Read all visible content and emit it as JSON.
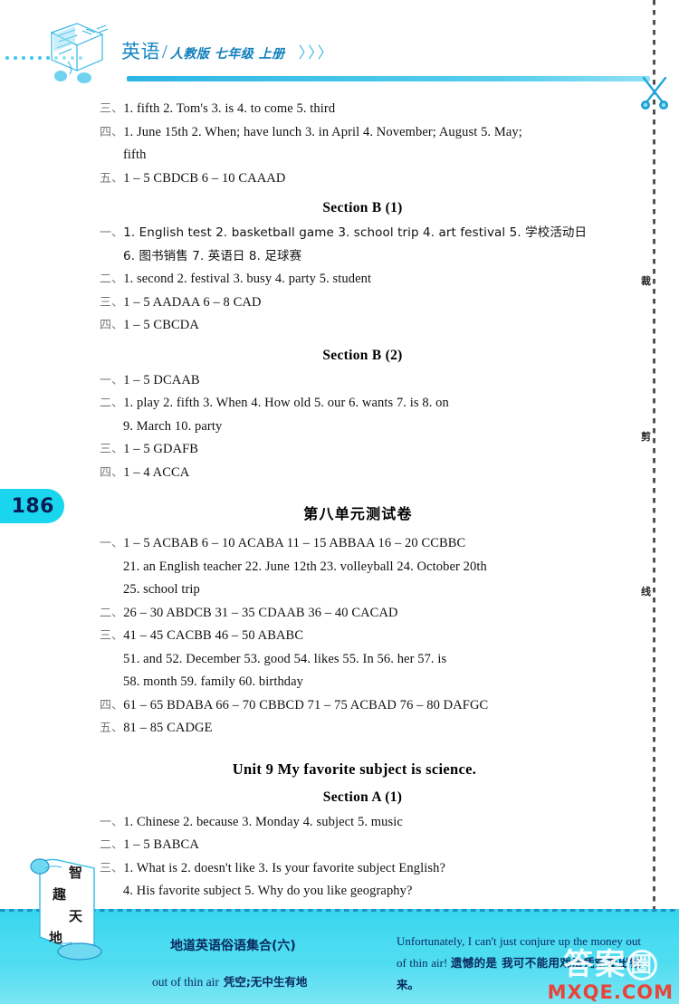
{
  "header": {
    "subject": "英语",
    "slash": "/",
    "edition": "人教版  七年级  上册",
    "chevrons": "〉〉〉"
  },
  "page_number": "186",
  "cut_line": {
    "scissors_icon": "scissors-icon",
    "chars": [
      "裁",
      "剪",
      "线"
    ]
  },
  "content": {
    "blocks": [
      {
        "lines": [
          {
            "num": "三、",
            "text": "1. fifth   2. Tom's   3. is   4. to come   5. third"
          },
          {
            "num": "四、",
            "text": "1. June 15th   2. When; have lunch   3. in April   4. November; August   5. May;"
          },
          {
            "num": "",
            "text": "fifth"
          },
          {
            "num": "五、",
            "text": "1 – 5 CBDCB   6 – 10 CAAAD"
          }
        ]
      }
    ],
    "heading_section_b1": "Section B (1)",
    "section_b1_lines": [
      {
        "num": "一、",
        "text": "1. English test   2. basketball game   3. school trip   4. art festival   5. 学校活动日"
      },
      {
        "num": "",
        "text": "6. 图书销售   7. 英语日    8. 足球赛"
      },
      {
        "num": "二、",
        "text": "1. second   2. festival   3. busy   4. party   5. student"
      },
      {
        "num": "三、",
        "text": "1 – 5 AADAA    6 – 8 CAD"
      },
      {
        "num": "四、",
        "text": "1 – 5 CBCDA"
      }
    ],
    "heading_section_b2": "Section B (2)",
    "section_b2_lines": [
      {
        "num": "一、",
        "text": "1 – 5 DCAAB"
      },
      {
        "num": "二、",
        "text": "1. play   2. fifth   3. When   4. How old   5. our   6. wants   7. is   8. on"
      },
      {
        "num": "",
        "text": "9. March   10. party"
      },
      {
        "num": "三、",
        "text": "1 – 5 GDAFB"
      },
      {
        "num": "四、",
        "text": "1 – 4 ACCA"
      }
    ],
    "heading_unit_test": "第八单元测试卷",
    "unit_test_lines": [
      {
        "num": "一、",
        "text": "1 – 5 ACBAB   6 – 10 ACABA   11 – 15 ABBAA   16 – 20 CCBBC"
      },
      {
        "num": "",
        "text": "21. an English teacher   22. June 12th   23. volleyball   24. October 20th"
      },
      {
        "num": "",
        "text": "25. school trip"
      },
      {
        "num": "二、",
        "text": "26 – 30 ABDCB   31 – 35 CDAAB   36 – 40 CACAD"
      },
      {
        "num": "三、",
        "text": "41 – 45 CACBB   46 – 50 ABABC"
      },
      {
        "num": "",
        "text": "51. and   52. December   53. good   54. likes   55. In   56. her   57. is"
      },
      {
        "num": "",
        "text": "58. month   59. family   60. birthday"
      },
      {
        "num": "四、",
        "text": "61 – 65 BDABA   66 – 70 CBBCD   71 – 75 ACBAD   76 – 80 DAFGC"
      },
      {
        "num": "五、",
        "text": "81 – 85 CADGE"
      }
    ],
    "heading_unit9": "Unit 9   My favorite subject is science.",
    "heading_section_a1": "Section A (1)",
    "section_a1_lines": [
      {
        "num": "一、",
        "text": "1. Chinese   2. because   3. Monday   4. subject   5. music"
      },
      {
        "num": "二、",
        "text": "1 – 5 BABCA"
      },
      {
        "num": "三、",
        "text": "1. What is   2. doesn't like   3. Is your favorite subject English?"
      },
      {
        "num": "",
        "text": "4. His favorite subject   5. Why do you like geography?"
      }
    ]
  },
  "scroll_badge": {
    "chars": [
      "智",
      "趣",
      "天",
      "地"
    ]
  },
  "footer": {
    "idiom_title": "地道英语俗语集合(六)",
    "idiom_entry_en": "out of thin air",
    "idiom_entry_cn": "凭空;无中生有地",
    "example_en_1": "Unfortunately, I can't just conjure up the money out of thin air!",
    "example_cn": "遗憾的是 我可不能用戏法凭空变出钱来。",
    "watermark_cn_1": "答案",
    "watermark_cn_2": "圈",
    "watermark_url": "MXQE.COM"
  },
  "colors": {
    "brand_blue": "#1487c4",
    "accent_cyan": "#19d6ee",
    "footer_cyan": "#4bdcf1",
    "watermark_red": "#e8443a",
    "page_num_text": "#0d1a52"
  }
}
